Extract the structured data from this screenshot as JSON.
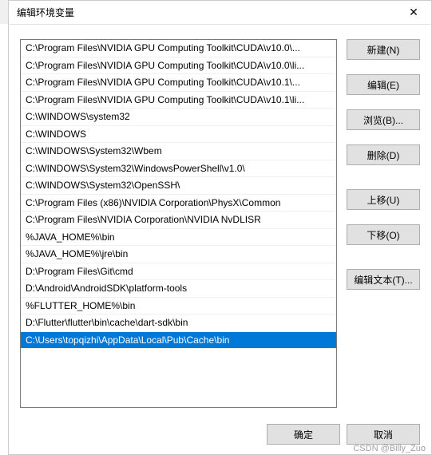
{
  "window": {
    "title": "编辑环境变量",
    "close_glyph": "✕"
  },
  "list": {
    "items": [
      "C:\\Program Files\\NVIDIA GPU Computing Toolkit\\CUDA\\v10.0\\...",
      "C:\\Program Files\\NVIDIA GPU Computing Toolkit\\CUDA\\v10.0\\li...",
      "C:\\Program Files\\NVIDIA GPU Computing Toolkit\\CUDA\\v10.1\\...",
      "C:\\Program Files\\NVIDIA GPU Computing Toolkit\\CUDA\\v10.1\\li...",
      "C:\\WINDOWS\\system32",
      "C:\\WINDOWS",
      "C:\\WINDOWS\\System32\\Wbem",
      "C:\\WINDOWS\\System32\\WindowsPowerShell\\v1.0\\",
      "C:\\WINDOWS\\System32\\OpenSSH\\",
      "C:\\Program Files (x86)\\NVIDIA Corporation\\PhysX\\Common",
      "C:\\Program Files\\NVIDIA Corporation\\NVIDIA NvDLISR",
      "%JAVA_HOME%\\bin",
      "%JAVA_HOME%\\jre\\bin",
      "D:\\Program Files\\Git\\cmd",
      "D:\\Android\\AndroidSDK\\platform-tools",
      "%FLUTTER_HOME%\\bin",
      "D:\\Flutter\\flutter\\bin\\cache\\dart-sdk\\bin",
      "C:\\Users\\topqizhi\\AppData\\Local\\Pub\\Cache\\bin"
    ],
    "selected_index": 17
  },
  "buttons": {
    "new": "新建(N)",
    "edit": "编辑(E)",
    "browse": "浏览(B)...",
    "delete": "删除(D)",
    "move_up": "上移(U)",
    "move_down": "下移(O)",
    "edit_text": "编辑文本(T)...",
    "ok": "确定",
    "cancel": "取消"
  },
  "watermark": "CSDN @Billy_Zuo"
}
